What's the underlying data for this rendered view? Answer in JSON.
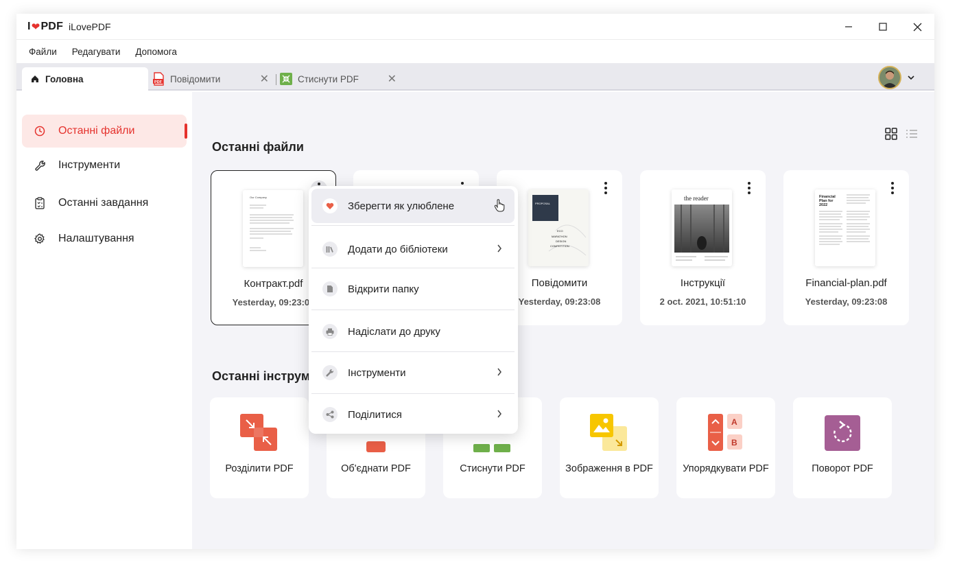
{
  "app": {
    "logo_text_left": "I",
    "logo_text_right": "PDF",
    "name": "iLovePDF"
  },
  "menu": [
    "Файли",
    "Редагувати",
    "Допомога"
  ],
  "tabs": [
    {
      "label": "Головна",
      "icon": "home-icon"
    },
    {
      "label": "Повідомити",
      "icon": "pdf-file-icon"
    },
    {
      "label": "Стиснути PDF",
      "icon": "compress-icon"
    }
  ],
  "sidebar": [
    {
      "label": "Останні файли",
      "icon": "clock-icon",
      "active": true
    },
    {
      "label": "Інструменти",
      "icon": "wrench-icon"
    },
    {
      "label": "Останні завдання",
      "icon": "clipboard-icon"
    },
    {
      "label": "Налаштування",
      "icon": "gear-icon"
    }
  ],
  "recent_files_title": "Останні файли",
  "recent_tools_title": "Останні інструм",
  "files": [
    {
      "name": "Контракт.pdf",
      "date": "Yesterday, 09:23:08",
      "thumb_title": "Our Company"
    },
    {
      "name": "",
      "date": ""
    },
    {
      "name": "Повідомити",
      "date": "Yesterday, 09:23:08",
      "thumb_title": "PROPOSAL",
      "thumb_sub": "ECO MARATHON DESIGN COMPETITION"
    },
    {
      "name": "Інструкції",
      "date": "2 oct. 2021, 10:51:10",
      "thumb_title": "the reader"
    },
    {
      "name": "Financial-plan.pdf",
      "date": "Yesterday, 09:23:08",
      "thumb_title": "Financial Plan for 2022"
    }
  ],
  "tools": [
    {
      "label": "Розділити PDF",
      "icon": "split-pdf-icon"
    },
    {
      "label": "Об'єднати PDF",
      "icon": "merge-pdf-icon"
    },
    {
      "label": "Стиснути PDF",
      "icon": "compress-pdf-icon"
    },
    {
      "label": "Зображення в PDF",
      "icon": "image-to-pdf-icon"
    },
    {
      "label": "Упорядкувати PDF",
      "icon": "organize-pdf-icon"
    },
    {
      "label": "Поворот PDF",
      "icon": "rotate-pdf-icon"
    }
  ],
  "context_menu": [
    {
      "label": "Зберегти як улюблене",
      "icon": "heart-icon",
      "submenu": false
    },
    {
      "label": "Додати до бібліотеки",
      "icon": "library-icon",
      "submenu": true
    },
    {
      "label": "Відкрити папку",
      "icon": "file-icon",
      "submenu": false
    },
    {
      "label": "Надіслати до друку",
      "icon": "printer-icon",
      "submenu": false
    },
    {
      "label": "Інструменти",
      "icon": "wrench-icon",
      "submenu": true
    },
    {
      "label": "Поділитися",
      "icon": "share-icon",
      "submenu": true
    }
  ],
  "organize_letters": [
    "A",
    "B"
  ],
  "colors": {
    "accent": "#e5322d",
    "sidebar_active_bg": "#fde8e6",
    "main_bg": "#f4f4f8"
  }
}
